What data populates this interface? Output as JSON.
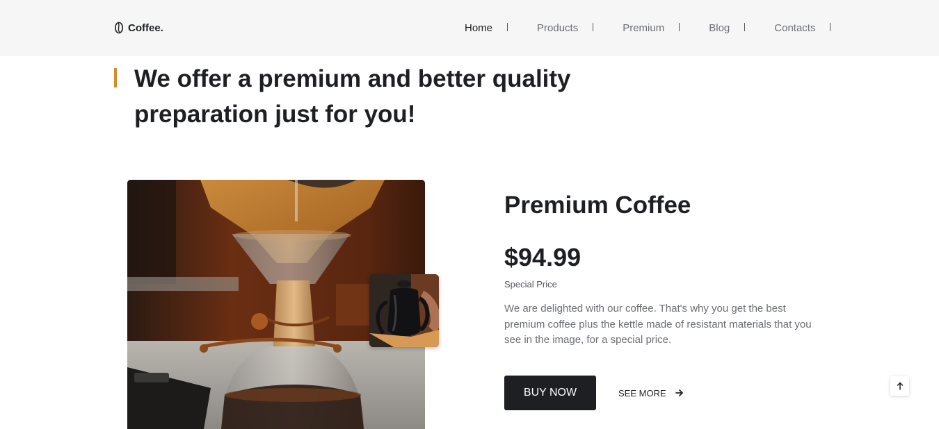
{
  "header": {
    "logo_icon": "coffee-bean-icon",
    "logo_text": "Coffee.",
    "nav": [
      {
        "label": "Home",
        "active": true
      },
      {
        "label": "Products",
        "active": false
      },
      {
        "label": "Premium",
        "active": false
      },
      {
        "label": "Blog",
        "active": false
      },
      {
        "label": "Contacts",
        "active": false
      }
    ]
  },
  "hero": {
    "headline": "We offer a premium and better quality preparation just for you!"
  },
  "product": {
    "title": "Premium Coffee",
    "price": "$94.99",
    "price_label": "Special Price",
    "description": "We are delighted with our coffee. That's why you get the best premium coffee plus the kettle made of resistant materials that you see in the image, for a special price.",
    "buy_label": "BUY NOW",
    "see_more_label": "SEE MORE",
    "see_more_icon": "arrow-right-icon"
  },
  "scroll_top_icon": "arrow-up-icon",
  "colors": {
    "accent": "#d28e2c",
    "dark": "#1d1f22",
    "header_bg": "#f6f6f6",
    "muted_text": "#6b6e73"
  }
}
